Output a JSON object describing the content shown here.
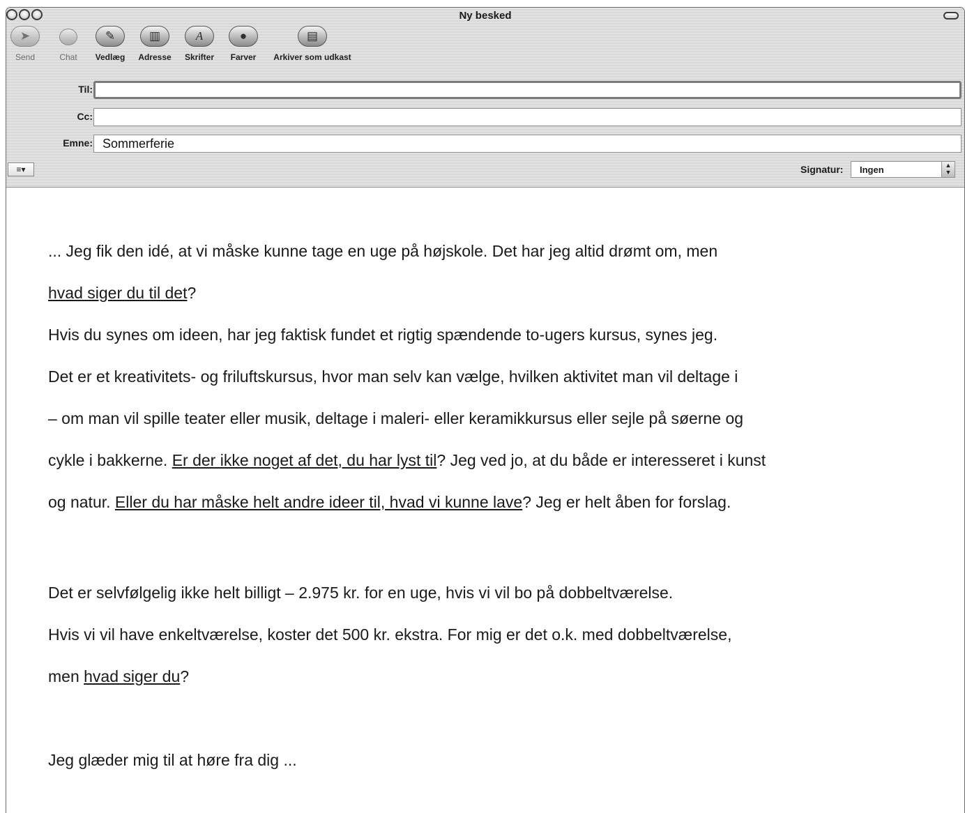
{
  "window": {
    "title": "Ny besked"
  },
  "toolbar": {
    "buttons": [
      {
        "label": "Send",
        "icon": "send-icon",
        "glyph": "➤"
      },
      {
        "label": "Chat",
        "icon": "chat-icon",
        "glyph": ""
      },
      {
        "label": "Vedlæg",
        "icon": "paperclip-icon",
        "glyph": "✎"
      },
      {
        "label": "Adresse",
        "icon": "address-book-icon",
        "glyph": "▥"
      },
      {
        "label": "Skrifter",
        "icon": "fonts-icon",
        "glyph": "A"
      },
      {
        "label": "Farver",
        "icon": "colors-icon",
        "glyph": "●"
      },
      {
        "label": "Arkiver som udkast",
        "icon": "save-draft-icon",
        "glyph": "▤"
      }
    ]
  },
  "headers": {
    "to_label": "Til:",
    "to_value": "",
    "cc_label": "Cc:",
    "cc_value": "",
    "subject_label": "Emne:",
    "subject_value": "Sommerferie",
    "signature_label": "Signatur:",
    "signature_value": "Ingen"
  },
  "message": {
    "l1": "... Jeg fik den idé, at vi måske kunne tage en uge på højskole. Det har jeg altid drømt om, men",
    "l2_u": "hvad siger du til det",
    "l2_rest": "?",
    "l3": "Hvis du synes om ideen, har jeg faktisk fundet et rigtig spændende to-ugers kursus, synes jeg.",
    "l4": "Det er et kreativitets- og friluftskursus, hvor man selv kan vælge, hvilken aktivitet man vil deltage i",
    "l5": "– om man vil spille teater eller musik, deltage i maleri- eller keramikkursus eller sejle på søerne og",
    "l6_a": "cykle i bakkerne. ",
    "l6_u": "Er der ikke noget af det, du har lyst til",
    "l6_b": "? Jeg ved jo, at du både er interesseret i kunst",
    "l7_a": "og natur. ",
    "l7_u": "Eller du har måske helt andre ideer til, hvad vi kunne lave",
    "l7_b": "? Jeg er helt åben for forslag.",
    "l8": "Det er selvfølgelig ikke helt billigt – 2.975 kr. for en uge, hvis vi vil bo på dobbeltværelse.",
    "l9": "Hvis vi vil have enkeltværelse, koster det 500 kr. ekstra. For mig er det o.k. med dobbeltværelse,",
    "l10_a": "men ",
    "l10_u": "hvad siger du",
    "l10_b": "?",
    "l11": "Jeg glæder mig til at høre fra dig ..."
  }
}
